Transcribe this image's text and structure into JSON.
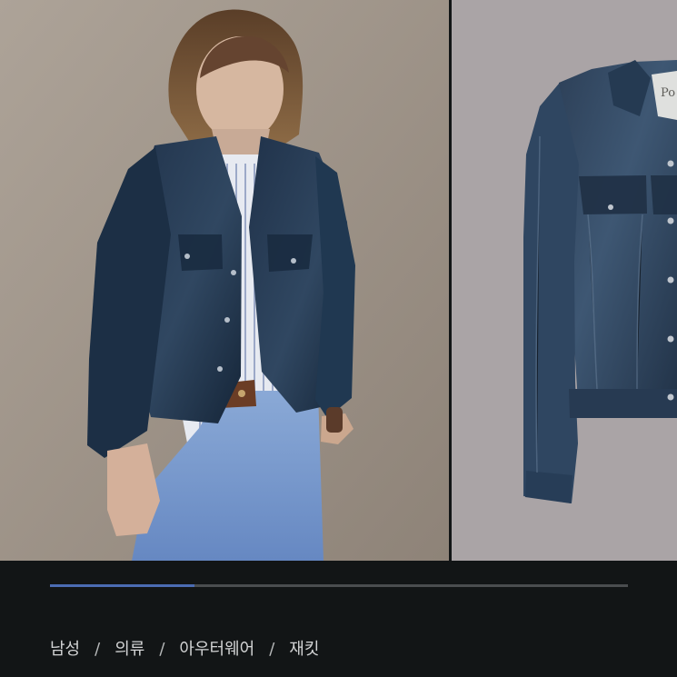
{
  "gallery": {
    "images": [
      {
        "alt": "Model wearing indigo denim trucker jacket"
      },
      {
        "alt": "Indigo denim trucker jacket product view"
      }
    ],
    "progress": 0.25
  },
  "breadcrumb": {
    "items": [
      "남성",
      "의류",
      "아우터웨어",
      "재킷"
    ],
    "separator": "/"
  }
}
